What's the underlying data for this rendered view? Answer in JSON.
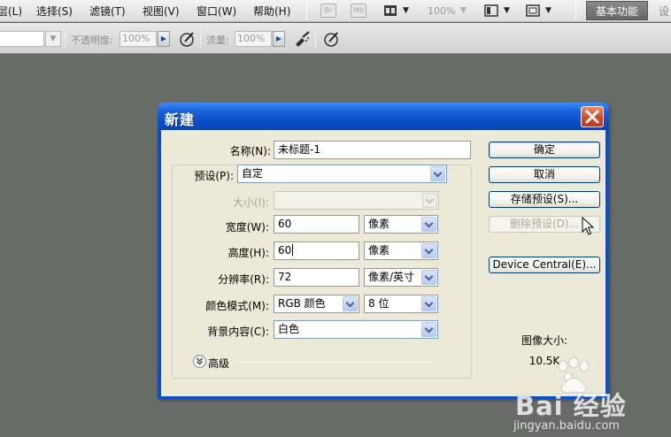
{
  "menubar": {
    "items": [
      "层(L)",
      "选择(S)",
      "滤镜(T)",
      "视图(V)",
      "窗口(W)",
      "帮助(H)"
    ],
    "bridge_label": "Br",
    "mini_bridge_label": "Mb",
    "zoom": "100%",
    "workspace_button": "基本功能",
    "overflow_text": "设"
  },
  "optbar": {
    "opacity_label": "不透明度:",
    "opacity_value": "100%",
    "flow_label": "流量:",
    "flow_value": "100%"
  },
  "dialog": {
    "title": "新建",
    "name_label": "名称(N):",
    "name_value": "未标题-1",
    "preset_label": "预设(P):",
    "preset_value": "自定",
    "size_label": "大小(I):",
    "size_value": "",
    "width_label": "宽度(W):",
    "width_value": "60",
    "width_unit": "像素",
    "height_label": "高度(H):",
    "height_value": "60",
    "height_unit": "像素",
    "resolution_label": "分辨率(R):",
    "resolution_value": "72",
    "resolution_unit": "像素/英寸",
    "color_mode_label": "颜色模式(M):",
    "color_mode_value": "RGB 颜色",
    "bit_depth_value": "8 位",
    "background_label": "背景内容(C):",
    "background_value": "白色",
    "advanced_label": "高级",
    "buttons": {
      "ok": "确定",
      "cancel": "取消",
      "save_preset": "存储预设(S)...",
      "delete_preset": "删除预设(D)...",
      "device_central": "Device Central(E)..."
    },
    "image_size_label": "图像大小:",
    "image_size_value": "10.5K"
  },
  "watermark": {
    "brand": "Bai 经验",
    "url": "jingyan.baidu.com"
  },
  "colors": {
    "workspace_bg": "#696b69",
    "dialog_frame": "#0a4ec6",
    "dialog_client": "#ece9d8",
    "close_red": "#d6461f"
  }
}
